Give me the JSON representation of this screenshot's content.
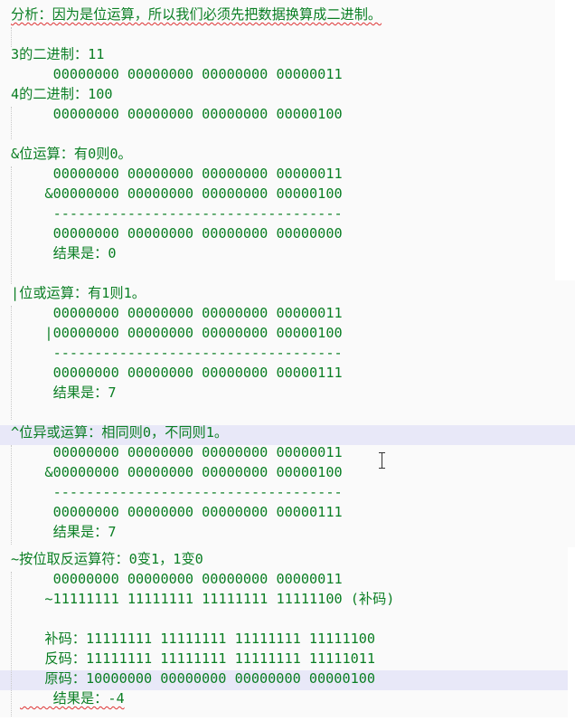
{
  "lines": [
    "分析：因为是位运算，所以我们必须先把数据换算成二进制。",
    "",
    "3的二进制：11",
    "    00000000 00000000 00000000 00000011",
    "4的二进制：100",
    "    00000000 00000000 00000000 00000100",
    "",
    "&位运算：有0则0。",
    "    00000000 00000000 00000000 00000011",
    "   &00000000 00000000 00000000 00000100",
    "    -----------------------------------",
    "    00000000 00000000 00000000 00000000",
    "    结果是：0",
    "",
    "|位或运算：有1则1。",
    "    00000000 00000000 00000000 00000011",
    "   |00000000 00000000 00000000 00000100",
    "    -----------------------------------",
    "    00000000 00000000 00000000 00000111",
    "    结果是：7",
    "",
    "^位异或运算：相同则0，不同则1。",
    "    00000000 00000000 00000000 00000011",
    "   &00000000 00000000 00000000 00000100",
    "    -----------------------------------",
    "    00000000 00000000 00000000 00000111",
    "    结果是：7",
    "~按位取反运算符：0变1，1变0",
    "    00000000 00000000 00000000 00000011",
    "   ~11111111 11111111 11111111 11111100 (补码)",
    "",
    "   补码：11111111 11111111 11111111 11111100",
    "   反码：11111111 11111111 11111111 11111011",
    "   原码：10000000 00000000 00000000 00000100",
    "    结果是：-4"
  ]
}
